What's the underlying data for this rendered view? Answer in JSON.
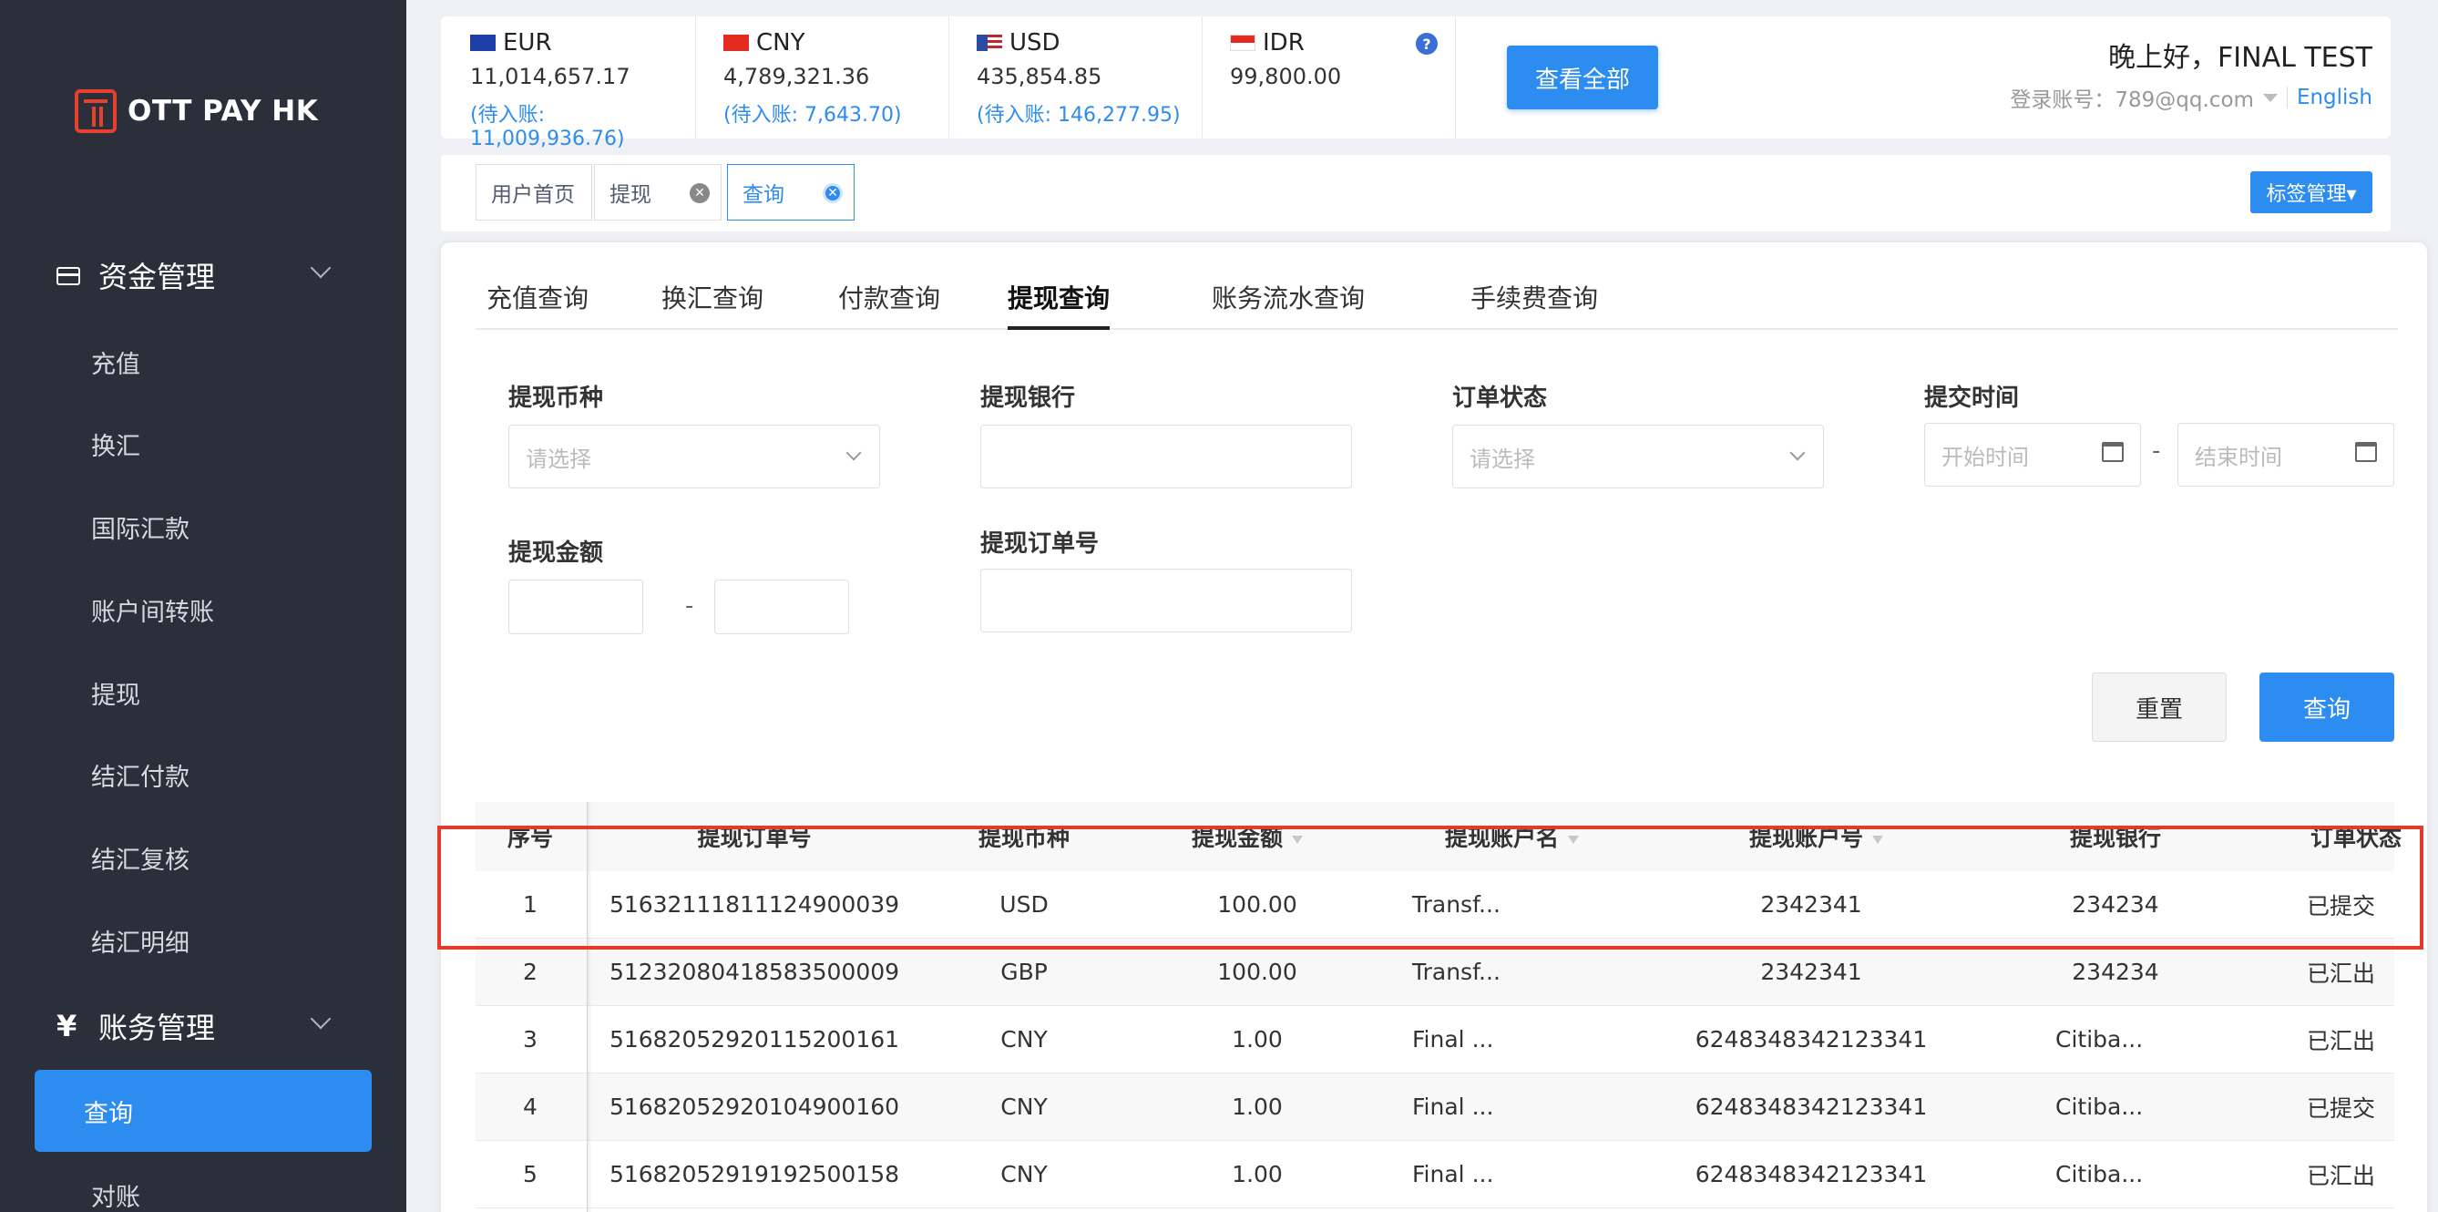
{
  "brand": {
    "name": "OTT PAY HK"
  },
  "sidebar": {
    "groups": [
      {
        "label": "资金管理",
        "icon": "card-icon"
      },
      {
        "label": "账务管理",
        "icon": "yen-icon",
        "symbol": "¥"
      }
    ],
    "fund_items": [
      "充值",
      "换汇",
      "国际汇款",
      "账户间转账",
      "提现",
      "结汇付款",
      "结汇复核",
      "结汇明细"
    ],
    "account_items": [
      "查询",
      "对账"
    ]
  },
  "currencies": [
    {
      "code": "EUR",
      "balance": "11,014,657.17",
      "pending": "(待入账: 11,009,936.76)"
    },
    {
      "code": "CNY",
      "balance": "4,789,321.36",
      "pending": "(待入账: 7,643.70)"
    },
    {
      "code": "USD",
      "balance": "435,854.85",
      "pending": "(待入账: 146,277.95)"
    },
    {
      "code": "IDR",
      "balance": "99,800.00",
      "pending": ""
    }
  ],
  "header": {
    "view_all": "查看全部",
    "greeting": "晚上好，FINAL TEST",
    "login_label": "登录账号：789@qq.com",
    "language": "English",
    "help": "?"
  },
  "page_tabs": [
    {
      "label": "用户首页",
      "closable": false
    },
    {
      "label": "提现",
      "closable": true
    },
    {
      "label": "查询",
      "closable": true,
      "active": true
    }
  ],
  "tag_manager": "标签管理▾",
  "sub_tabs": [
    "充值查询",
    "换汇查询",
    "付款查询",
    "提现查询",
    "账务流水查询",
    "手续费查询"
  ],
  "sub_tab_active": "提现查询",
  "filters": {
    "currency_label": "提现币种",
    "currency_placeholder": "请选择",
    "bank_label": "提现银行",
    "status_label": "订单状态",
    "status_placeholder": "请选择",
    "time_label": "提交时间",
    "time_start": "开始时间",
    "time_end": "结束时间",
    "amount_label": "提现金额",
    "order_label": "提现订单号",
    "dash": "-"
  },
  "buttons": {
    "reset": "重置",
    "query": "查询"
  },
  "table": {
    "headers": [
      "序号",
      "提现订单号",
      "提现币种",
      "提现金额",
      "提现账户名",
      "提现账户号",
      "提现银行",
      "订单状态"
    ],
    "rows": [
      {
        "no": "1",
        "order": "51632111811124900039",
        "currency": "USD",
        "amount": "100.00",
        "name": "Transf...",
        "account": "2342341",
        "bank": "234234",
        "status": "已提交"
      },
      {
        "no": "2",
        "order": "51232080418583500009",
        "currency": "GBP",
        "amount": "100.00",
        "name": "Transf...",
        "account": "2342341",
        "bank": "234234",
        "status": "已汇出"
      },
      {
        "no": "3",
        "order": "51682052920115200161",
        "currency": "CNY",
        "amount": "1.00",
        "name": "Final ...",
        "account": "6248348342123341",
        "bank": "Citiba...",
        "status": "已汇出"
      },
      {
        "no": "4",
        "order": "51682052920104900160",
        "currency": "CNY",
        "amount": "1.00",
        "name": "Final ...",
        "account": "6248348342123341",
        "bank": "Citiba...",
        "status": "已提交"
      },
      {
        "no": "5",
        "order": "51682052919192500158",
        "currency": "CNY",
        "amount": "1.00",
        "name": "Final ...",
        "account": "6248348342123341",
        "bank": "Citiba...",
        "status": "已汇出"
      }
    ]
  },
  "colors": {
    "primary": "#2d8cf0",
    "sidebar_bg": "#2b2f3a",
    "brand_red": "#e8402f",
    "highlight": "#e53a2b"
  }
}
